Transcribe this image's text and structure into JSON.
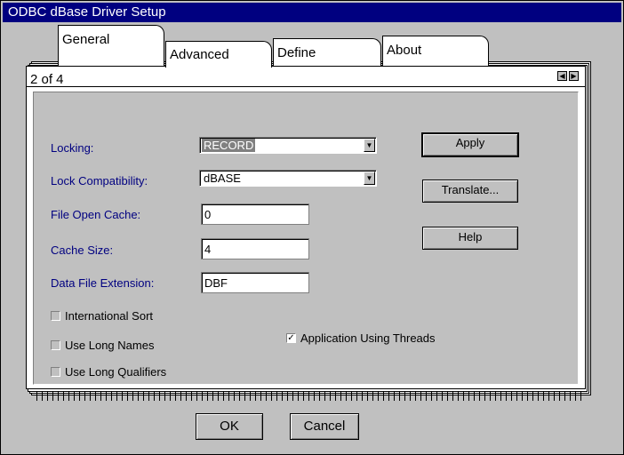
{
  "window": {
    "title": "ODBC dBase Driver Setup"
  },
  "tabs": [
    "General",
    "Advanced",
    "Define",
    "About"
  ],
  "page_indicator": "2 of 4",
  "icons": [
    "page-prev-icon",
    "page-next-icon",
    "dropdown-arrow-icon",
    "checkmark-icon"
  ],
  "fields": {
    "locking": {
      "label": "Locking:",
      "value": "RECORD"
    },
    "lock_compat": {
      "label": "Lock Compatibility:",
      "value": "dBASE"
    },
    "file_open_cache": {
      "label": "File Open Cache:",
      "value": "0"
    },
    "cache_size": {
      "label": "Cache Size:",
      "value": "4"
    },
    "data_file_ext": {
      "label": "Data File Extension:",
      "value": "DBF"
    }
  },
  "checkboxes": {
    "intl_sort": {
      "label": "International Sort",
      "checked": false
    },
    "long_names": {
      "label": "Use Long Names",
      "checked": false
    },
    "long_qualifiers": {
      "label": "Use Long Qualifiers",
      "checked": false
    },
    "app_threads": {
      "label": "Application Using Threads",
      "checked": true
    }
  },
  "buttons": {
    "apply": "Apply",
    "translate": "Translate...",
    "help": "Help",
    "ok": "OK",
    "cancel": "Cancel"
  }
}
